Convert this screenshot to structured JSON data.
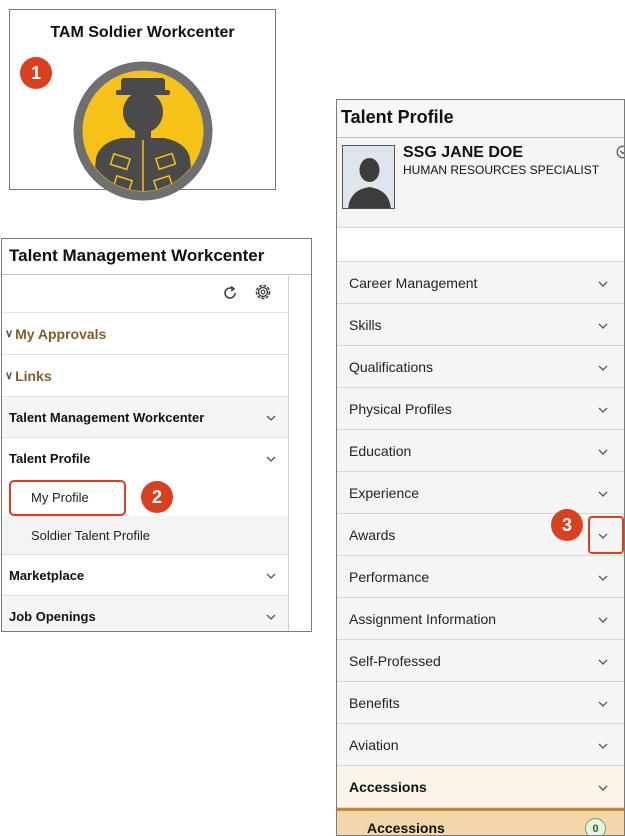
{
  "tile": {
    "title": "TAM Soldier Workcenter",
    "badge": "1",
    "icon": "soldier-icon",
    "colors": {
      "ring": "#6f6f6f",
      "fill": "#f7c218",
      "figure": "#4a4a4a"
    }
  },
  "workcenter": {
    "title": "Talent Management Workcenter",
    "tools": [
      "refresh-icon",
      "gear-icon"
    ],
    "sections": [
      {
        "label": "My Approvals"
      },
      {
        "label": "Links"
      }
    ],
    "items": [
      {
        "label": "Talent Management Workcenter"
      },
      {
        "label": "Talent Profile"
      }
    ],
    "subitems": [
      {
        "label": "My Profile",
        "badge": "2"
      },
      {
        "label": "Soldier Talent Profile"
      }
    ],
    "items_after": [
      {
        "label": "Marketplace"
      },
      {
        "label": "Job Openings"
      }
    ]
  },
  "talent_profile": {
    "title": "Talent Profile",
    "person": {
      "name": "SSG JANE DOE",
      "role": "HUMAN RESOURCES SPECIALIST"
    },
    "badge": "3",
    "items": [
      "Career Management",
      "Skills",
      "Qualifications",
      "Physical Profiles",
      "Education",
      "Experience",
      "Awards",
      "Performance",
      "Assignment Information",
      "Self-Professed",
      "Benefits",
      "Aviation",
      "Accessions"
    ],
    "subitem": {
      "label": "Accessions",
      "count": "0"
    },
    "colors": {
      "accent": "#c6873c",
      "callout": "#d9401f"
    }
  }
}
